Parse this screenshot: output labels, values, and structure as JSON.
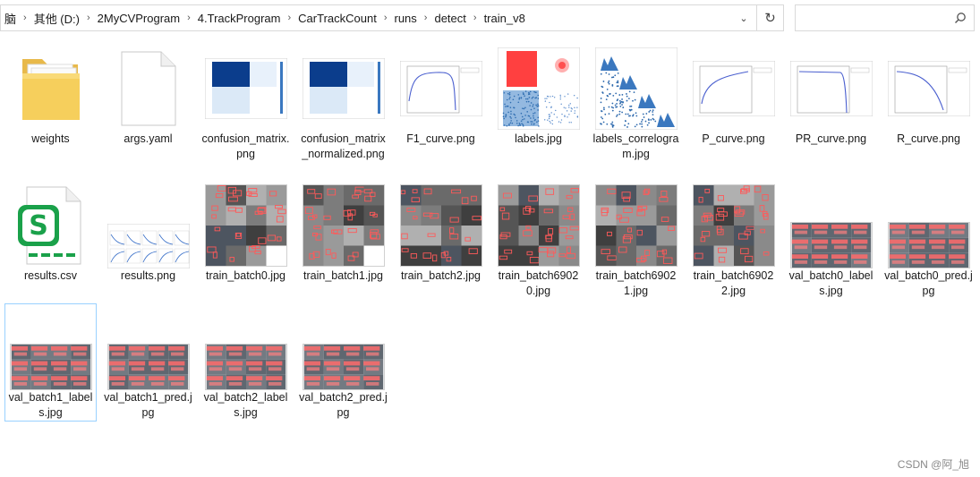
{
  "breadcrumb": [
    "脑",
    "其他 (D:)",
    "2MyCVProgram",
    "4.TrackProgram",
    "CarTrackCount",
    "runs",
    "detect",
    "train_v8"
  ],
  "search": {
    "placeholder": ""
  },
  "files": [
    {
      "name": "weights",
      "kind": "folder"
    },
    {
      "name": "args.yaml",
      "kind": "doc"
    },
    {
      "name": "confusion_matrix.png",
      "kind": "confusion"
    },
    {
      "name": "confusion_matrix_normalized.png",
      "kind": "confusion"
    },
    {
      "name": "F1_curve.png",
      "kind": "curve-f1"
    },
    {
      "name": "labels.jpg",
      "kind": "labels"
    },
    {
      "name": "labels_correlogram.jpg",
      "kind": "correlogram"
    },
    {
      "name": "P_curve.png",
      "kind": "curve-p"
    },
    {
      "name": "PR_curve.png",
      "kind": "curve-pr"
    },
    {
      "name": "R_curve.png",
      "kind": "curve-r"
    },
    {
      "name": "results.csv",
      "kind": "csv"
    },
    {
      "name": "results.png",
      "kind": "results"
    },
    {
      "name": "train_batch0.jpg",
      "kind": "batch"
    },
    {
      "name": "train_batch1.jpg",
      "kind": "batch"
    },
    {
      "name": "train_batch2.jpg",
      "kind": "batch"
    },
    {
      "name": "train_batch69020.jpg",
      "kind": "batch2"
    },
    {
      "name": "train_batch69021.jpg",
      "kind": "batch2"
    },
    {
      "name": "train_batch69022.jpg",
      "kind": "batch2"
    },
    {
      "name": "val_batch0_labels.jpg",
      "kind": "val"
    },
    {
      "name": "val_batch0_pred.jpg",
      "kind": "val"
    },
    {
      "name": "val_batch1_labels.jpg",
      "kind": "val",
      "selected": true
    },
    {
      "name": "val_batch1_pred.jpg",
      "kind": "val"
    },
    {
      "name": "val_batch2_labels.jpg",
      "kind": "val"
    },
    {
      "name": "val_batch2_pred.jpg",
      "kind": "val"
    }
  ],
  "watermark": "CSDN @阿_旭"
}
